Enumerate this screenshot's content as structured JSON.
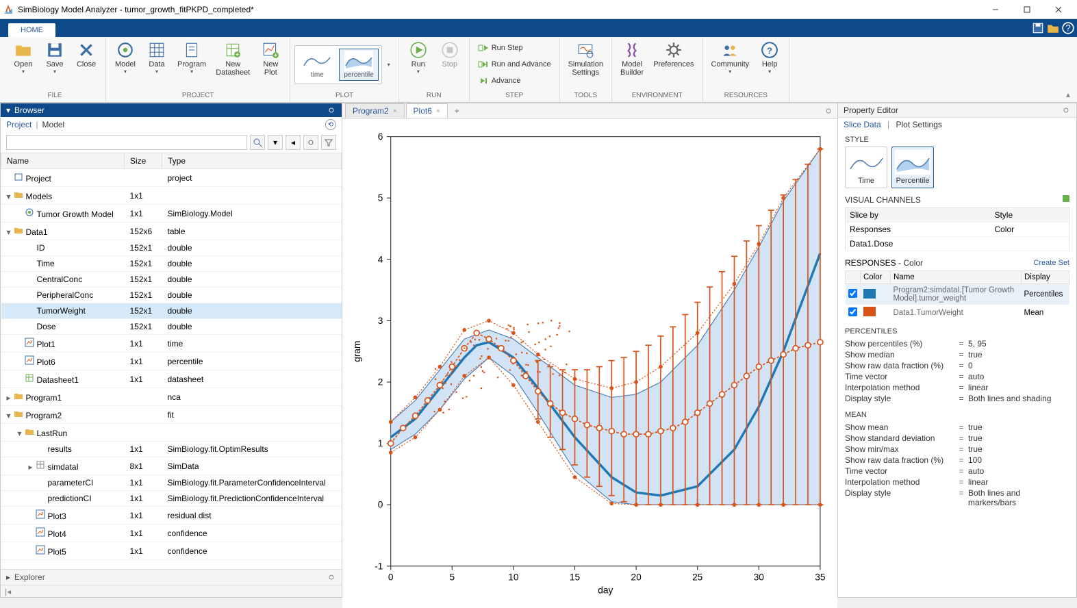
{
  "title": "SimBiology Model Analyzer - tumor_growth_fitPKPD_completed*",
  "ribbon": {
    "tab": "HOME",
    "groups": {
      "file": {
        "label": "FILE",
        "open": "Open",
        "save": "Save",
        "close": "Close"
      },
      "project": {
        "label": "PROJECT",
        "model": "Model",
        "data": "Data",
        "program": "Program",
        "new_datasheet": "New\nDatasheet",
        "new_plot": "New\nPlot"
      },
      "plot": {
        "label": "PLOT",
        "time": "time",
        "percentile": "percentile"
      },
      "run": {
        "label": "RUN",
        "run": "Run",
        "stop": "Stop"
      },
      "step": {
        "label": "STEP",
        "run_step": "Run Step",
        "run_advance": "Run and Advance",
        "advance": "Advance"
      },
      "tools": {
        "label": "TOOLS",
        "sim_settings": "Simulation\nSettings"
      },
      "environment": {
        "label": "ENVIRONMENT",
        "model_builder": "Model\nBuilder",
        "preferences": "Preferences"
      },
      "resources": {
        "label": "RESOURCES",
        "community": "Community",
        "help": "Help"
      }
    }
  },
  "browser": {
    "panel_title": "Browser",
    "sub_project": "Project",
    "sub_model": "Model",
    "search_placeholder": "",
    "columns": {
      "name": "Name",
      "size": "Size",
      "type": "Type"
    },
    "rows": [
      {
        "indent": 0,
        "icon": "project-icon",
        "name": "Project",
        "size": "",
        "type": "project",
        "arrow": ""
      },
      {
        "indent": 0,
        "icon": "folder-icon",
        "name": "Models",
        "size": "1x1",
        "type": "",
        "arrow": "▾"
      },
      {
        "indent": 1,
        "icon": "model-icon",
        "name": "Tumor Growth Model",
        "size": "1x1",
        "type": "SimBiology.Model",
        "arrow": ""
      },
      {
        "indent": 0,
        "icon": "folder-icon",
        "name": "Data1",
        "size": "152x6",
        "type": "table",
        "arrow": "▾"
      },
      {
        "indent": 1,
        "icon": "",
        "name": "ID",
        "size": "152x1",
        "type": "double",
        "arrow": ""
      },
      {
        "indent": 1,
        "icon": "",
        "name": "Time",
        "size": "152x1",
        "type": "double",
        "arrow": ""
      },
      {
        "indent": 1,
        "icon": "",
        "name": "CentralConc",
        "size": "152x1",
        "type": "double",
        "arrow": ""
      },
      {
        "indent": 1,
        "icon": "",
        "name": "PeripheralConc",
        "size": "152x1",
        "type": "double",
        "arrow": ""
      },
      {
        "indent": 1,
        "icon": "",
        "name": "TumorWeight",
        "size": "152x1",
        "type": "double",
        "arrow": "",
        "selected": true
      },
      {
        "indent": 1,
        "icon": "",
        "name": "Dose",
        "size": "152x1",
        "type": "double",
        "arrow": ""
      },
      {
        "indent": 1,
        "icon": "plot-icon",
        "name": "Plot1",
        "size": "1x1",
        "type": "time",
        "arrow": ""
      },
      {
        "indent": 1,
        "icon": "plot-icon",
        "name": "Plot6",
        "size": "1x1",
        "type": "percentile",
        "arrow": ""
      },
      {
        "indent": 1,
        "icon": "sheet-icon",
        "name": "Datasheet1",
        "size": "1x1",
        "type": "datasheet",
        "arrow": ""
      },
      {
        "indent": 0,
        "icon": "folder-icon",
        "name": "Program1",
        "size": "",
        "type": "nca",
        "arrow": "▸"
      },
      {
        "indent": 0,
        "icon": "folder-icon",
        "name": "Program2",
        "size": "",
        "type": "fit",
        "arrow": "▾"
      },
      {
        "indent": 1,
        "icon": "folder-icon",
        "name": "LastRun",
        "size": "",
        "type": "",
        "arrow": "▾"
      },
      {
        "indent": 2,
        "icon": "",
        "name": "results",
        "size": "1x1",
        "type": "SimBiology.fit.OptimResults",
        "arrow": ""
      },
      {
        "indent": 2,
        "icon": "table-icon",
        "name": "simdataI",
        "size": "8x1",
        "type": "SimData",
        "arrow": "▸"
      },
      {
        "indent": 2,
        "icon": "",
        "name": "parameterCI",
        "size": "1x1",
        "type": "SimBiology.fit.ParameterConfidenceInterval",
        "arrow": ""
      },
      {
        "indent": 2,
        "icon": "",
        "name": "predictionCI",
        "size": "1x1",
        "type": "SimBiology.fit.PredictionConfidenceInterval",
        "arrow": ""
      },
      {
        "indent": 2,
        "icon": "plot-icon",
        "name": "Plot3",
        "size": "1x1",
        "type": "residual dist",
        "arrow": ""
      },
      {
        "indent": 2,
        "icon": "plot-icon",
        "name": "Plot4",
        "size": "1x1",
        "type": "confidence",
        "arrow": ""
      },
      {
        "indent": 2,
        "icon": "plot-icon",
        "name": "Plot5",
        "size": "1x1",
        "type": "confidence",
        "arrow": ""
      }
    ],
    "explorer": "Explorer"
  },
  "tabs": {
    "program2": "Program2",
    "plot6": "Plot6"
  },
  "chart_data": {
    "type": "line",
    "xlabel": "day",
    "ylabel": "gram",
    "xlim": [
      0,
      35
    ],
    "ylim": [
      -1,
      6
    ],
    "xticks": [
      0,
      5,
      10,
      15,
      20,
      25,
      30,
      35
    ],
    "yticks": [
      -1,
      0,
      1,
      2,
      3,
      4,
      5,
      6
    ],
    "series": [
      {
        "name": "median",
        "color": "#1f77b4",
        "x": [
          0,
          2,
          4,
          6,
          7,
          8,
          10,
          12,
          15,
          18,
          20,
          22,
          25,
          28,
          30,
          32,
          35
        ],
        "y": [
          1.1,
          1.4,
          1.9,
          2.4,
          2.6,
          2.65,
          2.4,
          1.9,
          1.1,
          0.45,
          0.2,
          0.15,
          0.3,
          0.9,
          1.6,
          2.5,
          4.1
        ]
      },
      {
        "name": "p95",
        "color": "#1f77b4",
        "x": [
          0,
          2,
          4,
          6,
          8,
          10,
          12,
          15,
          18,
          20,
          22,
          25,
          28,
          30,
          32,
          35
        ],
        "y": [
          1.35,
          1.7,
          2.2,
          2.7,
          2.85,
          2.7,
          2.4,
          1.95,
          1.75,
          1.8,
          2.0,
          2.6,
          3.5,
          4.2,
          4.95,
          5.8
        ]
      },
      {
        "name": "p5",
        "color": "#1f77b4",
        "x": [
          0,
          2,
          4,
          6,
          8,
          10,
          12,
          15,
          18,
          20,
          22,
          25,
          28,
          30,
          32,
          35
        ],
        "y": [
          0.9,
          1.15,
          1.55,
          2.05,
          2.4,
          2.1,
          1.5,
          0.55,
          0.05,
          0.0,
          0.0,
          0.0,
          0.0,
          0.0,
          0.0,
          0.0
        ]
      },
      {
        "name": "mean_data",
        "color": "#d95319",
        "x": [
          0,
          1,
          2,
          3,
          4,
          5,
          6,
          7,
          8,
          9,
          10,
          11,
          12,
          13,
          14,
          15,
          16,
          17,
          18,
          19,
          20,
          21,
          22,
          23,
          24,
          25,
          26,
          27,
          28,
          29,
          30,
          31,
          32,
          33,
          34,
          35
        ],
        "y": [
          1.0,
          1.25,
          1.45,
          1.7,
          1.95,
          2.25,
          2.55,
          2.8,
          2.7,
          2.55,
          2.35,
          2.1,
          1.85,
          1.65,
          1.5,
          1.4,
          1.3,
          1.25,
          1.2,
          1.15,
          1.15,
          1.15,
          1.2,
          1.25,
          1.35,
          1.5,
          1.65,
          1.8,
          1.95,
          2.1,
          2.25,
          2.35,
          2.45,
          2.55,
          2.6,
          2.65
        ]
      },
      {
        "name": "upper_data",
        "color": "#d95319",
        "x": [
          0,
          2,
          4,
          6,
          8,
          10,
          12,
          15,
          18,
          20,
          22,
          25,
          28,
          30,
          32,
          35
        ],
        "y": [
          1.35,
          1.75,
          2.25,
          2.85,
          3.0,
          2.8,
          2.45,
          2.05,
          1.9,
          2.0,
          2.25,
          2.8,
          3.6,
          4.25,
          5.0,
          5.8
        ]
      },
      {
        "name": "lower_data",
        "color": "#d95319",
        "x": [
          0,
          2,
          4,
          6,
          8,
          10,
          12,
          15,
          18,
          20,
          22,
          25,
          28,
          30,
          32,
          35
        ],
        "y": [
          0.85,
          1.1,
          1.55,
          2.1,
          2.4,
          1.95,
          1.35,
          0.45,
          0.02,
          0.0,
          0.0,
          0.0,
          0.0,
          0.0,
          0.0,
          0.0
        ]
      }
    ],
    "error_bars": {
      "x": [
        12,
        13,
        14,
        15,
        16,
        17,
        18,
        19,
        20,
        21,
        22,
        23,
        24,
        25,
        26,
        27,
        28,
        29,
        30,
        31,
        32,
        33,
        34,
        35
      ],
      "mean": [
        1.85,
        1.65,
        1.5,
        1.4,
        1.3,
        1.25,
        1.2,
        1.15,
        1.15,
        1.15,
        1.2,
        1.25,
        1.35,
        1.5,
        1.65,
        1.8,
        1.95,
        2.1,
        2.25,
        2.35,
        2.45,
        2.55,
        2.6,
        2.65
      ],
      "low": [
        1.4,
        1.1,
        0.9,
        0.65,
        0.45,
        0.3,
        0.15,
        0.05,
        0.0,
        0.0,
        0.0,
        0.0,
        0.0,
        0.0,
        0.0,
        0.0,
        0.0,
        0.0,
        0.0,
        0.0,
        0.0,
        0.0,
        0.0,
        0.0
      ],
      "high": [
        2.35,
        2.25,
        2.2,
        2.2,
        2.2,
        2.25,
        2.35,
        2.4,
        2.5,
        2.6,
        2.75,
        2.9,
        3.1,
        3.3,
        3.55,
        3.8,
        4.05,
        4.3,
        4.55,
        4.8,
        5.05,
        5.3,
        5.55,
        5.8
      ]
    }
  },
  "prop": {
    "title": "Property Editor",
    "slice_data": "Slice Data",
    "plot_settings": "Plot Settings",
    "style_title": "STYLE",
    "style_time": "Time",
    "style_percentile": "Percentile",
    "vc_title": "VISUAL CHANNELS",
    "vc_sliceby": "Slice by",
    "vc_style": "Style",
    "vc_rows": [
      {
        "sliceby": "Responses",
        "style": "Color"
      },
      {
        "sliceby": "Data1.Dose",
        "style": ""
      }
    ],
    "resp_title_a": "RESPONSES -",
    "resp_title_b": "Color",
    "resp_create": "Create Set",
    "resp_cols": {
      "color": "Color",
      "name": "Name",
      "display": "Display"
    },
    "resp_rows": [
      {
        "checked": true,
        "color": "#1f77b4",
        "name": "Program2:simdataI.[Tumor Growth Model].tumor_weight",
        "display": "Percentiles",
        "selected": true
      },
      {
        "checked": true,
        "color": "#d95319",
        "name": "Data1.TumorWeight",
        "display": "Mean"
      }
    ],
    "percentiles_title": "PERCENTILES",
    "percentiles": [
      {
        "k": "Show percentiles (%)",
        "v": "5, 95"
      },
      {
        "k": "Show median",
        "v": "true"
      },
      {
        "k": "Show raw data fraction (%)",
        "v": "0"
      },
      {
        "k": "Time vector",
        "v": "auto"
      },
      {
        "k": "Interpolation method",
        "v": "linear"
      },
      {
        "k": "Display style",
        "v": "Both lines and shading"
      }
    ],
    "mean_title": "MEAN",
    "mean": [
      {
        "k": "Show mean",
        "v": "true"
      },
      {
        "k": "Show standard deviation",
        "v": "true"
      },
      {
        "k": "Show min/max",
        "v": "true"
      },
      {
        "k": "Show raw data fraction (%)",
        "v": "100"
      },
      {
        "k": "Time vector",
        "v": "auto"
      },
      {
        "k": "Interpolation method",
        "v": "linear"
      },
      {
        "k": "Display style",
        "v": "Both lines and markers/bars"
      }
    ]
  }
}
